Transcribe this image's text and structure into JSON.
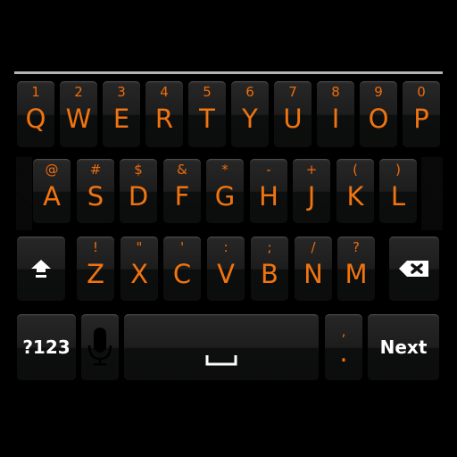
{
  "keyboard": {
    "accent_color": "#f07410",
    "row1": [
      {
        "letter": "Q",
        "symbol": "1"
      },
      {
        "letter": "W",
        "symbol": "2"
      },
      {
        "letter": "E",
        "symbol": "3"
      },
      {
        "letter": "R",
        "symbol": "4"
      },
      {
        "letter": "T",
        "symbol": "5"
      },
      {
        "letter": "Y",
        "symbol": "6"
      },
      {
        "letter": "U",
        "symbol": "7"
      },
      {
        "letter": "I",
        "symbol": "8"
      },
      {
        "letter": "O",
        "symbol": "9"
      },
      {
        "letter": "P",
        "symbol": "0"
      }
    ],
    "row2": [
      {
        "letter": "A",
        "symbol": "@"
      },
      {
        "letter": "S",
        "symbol": "#"
      },
      {
        "letter": "D",
        "symbol": "$"
      },
      {
        "letter": "F",
        "symbol": "&"
      },
      {
        "letter": "G",
        "symbol": "*"
      },
      {
        "letter": "H",
        "symbol": "-"
      },
      {
        "letter": "J",
        "symbol": "+"
      },
      {
        "letter": "K",
        "symbol": "("
      },
      {
        "letter": "L",
        "symbol": ")"
      }
    ],
    "row3": [
      {
        "letter": "Z",
        "symbol": "!"
      },
      {
        "letter": "X",
        "symbol": "\""
      },
      {
        "letter": "C",
        "symbol": "'"
      },
      {
        "letter": "V",
        "symbol": ":"
      },
      {
        "letter": "B",
        "symbol": ";"
      },
      {
        "letter": "N",
        "symbol": "/"
      },
      {
        "letter": "M",
        "symbol": "?"
      }
    ],
    "shift_icon": "shift-arrow-icon",
    "backspace_icon": "backspace-icon",
    "symbols_label": "?123",
    "mic_icon": "microphone-icon",
    "space_icon": "space-bar-icon",
    "period_key": {
      "main": ".",
      "symbol": ","
    },
    "action_label": "Next"
  }
}
